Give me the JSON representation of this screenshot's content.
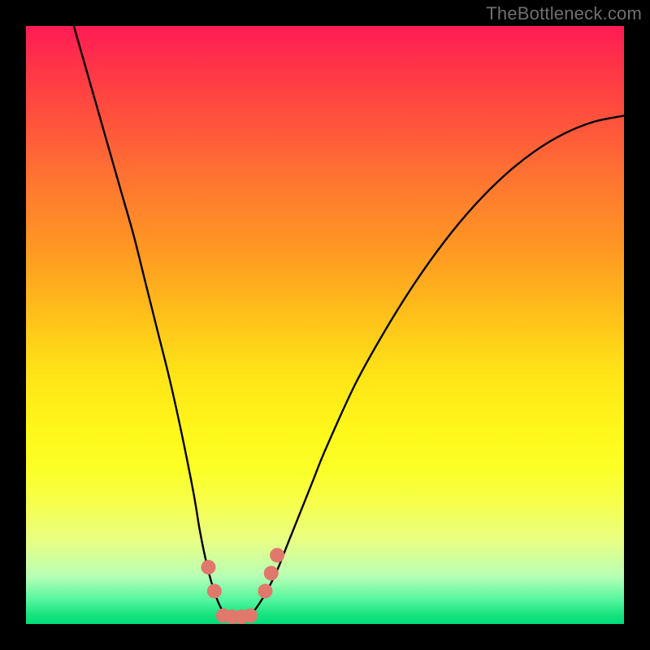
{
  "watermark": "TheBottleneck.com",
  "chart_data": {
    "type": "line",
    "title": "",
    "xlabel": "",
    "ylabel": "",
    "x_range": [
      0,
      100
    ],
    "y_range": [
      0,
      100
    ],
    "series": [
      {
        "name": "bottleneck-curve",
        "x": [
          8,
          10,
          12,
          14,
          16,
          18,
          20,
          22,
          24,
          26,
          28,
          29,
          30,
          31,
          32,
          33,
          34,
          35,
          36,
          37,
          38,
          40,
          42,
          44,
          46,
          48,
          50,
          55,
          60,
          65,
          70,
          75,
          80,
          85,
          90,
          95,
          100
        ],
        "y": [
          100,
          93,
          86,
          79,
          72,
          65,
          57,
          49,
          41,
          32,
          22,
          16,
          11,
          7,
          4,
          2,
          1.2,
          1,
          1,
          1.2,
          2,
          5,
          9,
          14,
          19,
          24,
          29,
          40,
          49,
          57,
          64,
          70,
          75,
          79,
          82,
          84,
          85
        ]
      }
    ],
    "markers": {
      "name": "highlight-dots",
      "color": "#e0786b",
      "points": [
        {
          "x": 30.5,
          "y": 9.5
        },
        {
          "x": 31.5,
          "y": 5.5
        },
        {
          "x": 33,
          "y": 1.4
        },
        {
          "x": 34.5,
          "y": 1.2
        },
        {
          "x": 36,
          "y": 1.2
        },
        {
          "x": 37.5,
          "y": 1.4
        },
        {
          "x": 40,
          "y": 5.5
        },
        {
          "x": 41,
          "y": 8.5
        },
        {
          "x": 42,
          "y": 11.5
        }
      ]
    },
    "gradient_stops": [
      {
        "pos": 0,
        "color": "#ff1b55"
      },
      {
        "pos": 50,
        "color": "#ffe317"
      },
      {
        "pos": 100,
        "color": "#00dd7a"
      }
    ]
  }
}
